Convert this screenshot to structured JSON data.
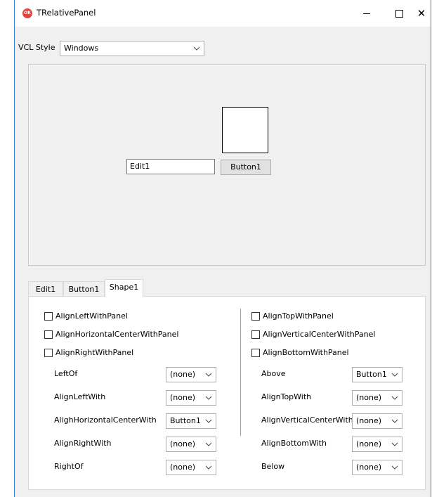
{
  "window": {
    "title": "TRelativePanel",
    "icon_name": "app-icon",
    "icon_text": "OK",
    "minimize_icon": "minimize-icon",
    "maximize_icon": "maximize-icon",
    "close_glyph": "✕"
  },
  "toolbar": {
    "vcl_style_label": "VCL Style",
    "vcl_style_value": "Windows"
  },
  "preview": {
    "edit1_text": "Edit1",
    "button1_label": "Button1"
  },
  "tabs": [
    {
      "label": "Edit1",
      "active": false
    },
    {
      "label": "Button1",
      "active": false
    },
    {
      "label": "Shape1",
      "active": true
    }
  ],
  "checkboxes_left": [
    {
      "label": "AlignLeftWithPanel",
      "checked": false
    },
    {
      "label": "AlignHorizontalCenterWithPanel",
      "checked": false
    },
    {
      "label": "AlignRightWithPanel",
      "checked": false
    }
  ],
  "checkboxes_right": [
    {
      "label": "AlignTopWithPanel",
      "checked": false
    },
    {
      "label": "AlignVerticalCenterWithPanel",
      "checked": false
    },
    {
      "label": "AlignBottomWithPanel",
      "checked": false
    }
  ],
  "props_left": [
    {
      "label": "LeftOf",
      "value": "(none)"
    },
    {
      "label": "AlignLeftWith",
      "value": "(none)"
    },
    {
      "label": "AlighHorizontalCenterWith",
      "value": "Button1"
    },
    {
      "label": "AlignRightWith",
      "value": "(none)"
    },
    {
      "label": "RightOf",
      "value": "(none)"
    }
  ],
  "props_right": [
    {
      "label": "Above",
      "value": "Button1"
    },
    {
      "label": "AlignTopWith",
      "value": "(none)"
    },
    {
      "label": "AlignVerticalCenterWith",
      "value": "(none)"
    },
    {
      "label": "AlignBottomWith",
      "value": "(none)"
    },
    {
      "label": "Below",
      "value": "(none)"
    }
  ],
  "colors": {
    "window_border": "#3b7fd0",
    "app_icon": "#e0463b",
    "form_background": "#f0f0f0"
  }
}
